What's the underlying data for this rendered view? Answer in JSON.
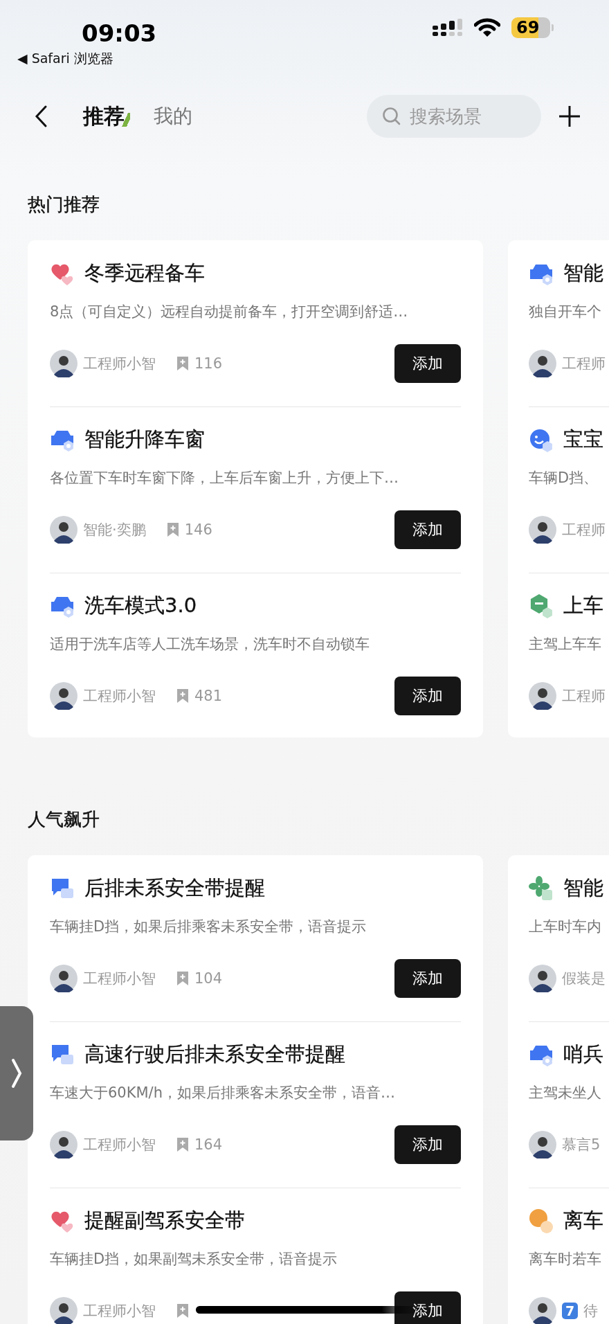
{
  "status_bar": {
    "time": "09:03",
    "back_app": "◀ Safari 浏览器",
    "battery": "69"
  },
  "nav": {
    "tabs": [
      {
        "label": "推荐",
        "selected": true
      },
      {
        "label": "我的",
        "selected": false
      }
    ],
    "search": {
      "placeholder": "搜索场景"
    }
  },
  "sections": [
    {
      "title": "热门推荐",
      "columns": [
        {
          "items": [
            {
              "kind": "heart",
              "title": "冬季远程备车",
              "description": "8点（可自定义）远程自动提前备车，打开空调到舒适…",
              "author": "工程师小智",
              "count": "116",
              "button": "添加"
            },
            {
              "kind": "car",
              "title": "智能升降车窗",
              "description": "各位置下车时车窗下降，上车后车窗上升，方便上下…",
              "author": "智能·奕鹏",
              "count": "146",
              "button": "添加"
            },
            {
              "kind": "car",
              "title": "洗车模式3.0",
              "description": "适用于洗车店等人工洗车场景，洗车时不自动锁车",
              "author": "工程师小智",
              "count": "481",
              "button": "添加"
            }
          ]
        },
        {
          "items": [
            {
              "kind": "car",
              "title": "智能",
              "description": "独自开车个",
              "author": "工程师"
            },
            {
              "kind": "face",
              "title": "宝宝",
              "description": "车辆D挡、",
              "author": "工程师"
            },
            {
              "kind": "box",
              "title": "上车",
              "description": "主驾上车车",
              "author": "工程师"
            }
          ]
        }
      ]
    },
    {
      "title": "人气飙升",
      "columns": [
        {
          "items": [
            {
              "kind": "chat",
              "title": "后排未系安全带提醒",
              "description": "车辆挂D挡，如果后排乘客未系安全带，语音提示",
              "author": "工程师小智",
              "count": "104",
              "button": "添加"
            },
            {
              "kind": "chat",
              "title": "高速行驶后排未系安全带提醒",
              "description": "车速大于60KM/h，如果后排乘客未系安全带，语音…",
              "author": "工程师小智",
              "count": "164",
              "button": "添加"
            },
            {
              "kind": "heart",
              "title": "提醒副驾系安全带",
              "description": "车辆挂D挡，如果副驾未系安全带，语音提示",
              "author": "工程师小智",
              "button": "添加"
            }
          ]
        },
        {
          "items": [
            {
              "kind": "fan",
              "title": "智能",
              "description": "上车时车内",
              "author": "假装是"
            },
            {
              "kind": "car",
              "title": "哨兵",
              "description": "主驾未坐人",
              "author": "慕言5"
            },
            {
              "kind": "bulb",
              "title": "离车",
              "description": "离车时若车",
              "author_badge": "7",
              "author": "待"
            }
          ]
        }
      ]
    }
  ]
}
